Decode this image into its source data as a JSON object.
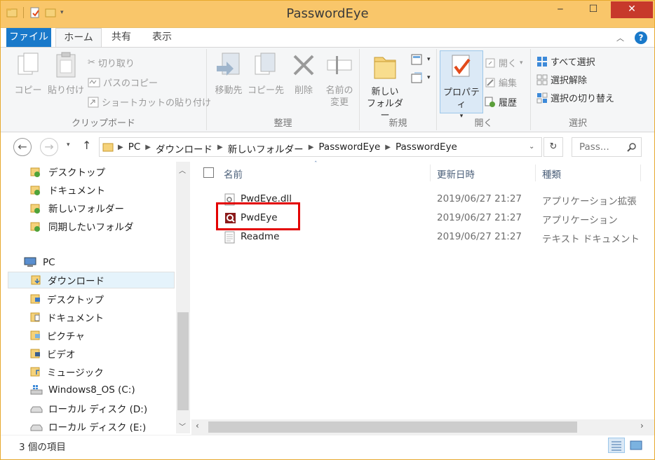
{
  "window": {
    "title": "PasswordEye",
    "controls": {
      "minimize": "‒",
      "maximize": "☐",
      "close": "✕"
    }
  },
  "tabs": {
    "file": "ファイル",
    "home": "ホーム",
    "share": "共有",
    "view": "表示",
    "help": "?"
  },
  "ribbon": {
    "clipboard": {
      "label": "クリップボード",
      "copy": "コピー",
      "paste": "貼り付け",
      "cut": "切り取り",
      "copy_path": "パスのコピー",
      "paste_shortcut": "ショートカットの貼り付け"
    },
    "organize": {
      "label": "整理",
      "move_to": "移動先",
      "copy_to": "コピー先",
      "delete": "削除",
      "rename_line1": "名前の",
      "rename_line2": "変更"
    },
    "new": {
      "label": "新規",
      "new_folder_line1": "新しい",
      "new_folder_line2": "フォルダー"
    },
    "open": {
      "label": "開く",
      "properties": "プロパティ",
      "open": "開く",
      "edit": "編集",
      "history": "履歴"
    },
    "select": {
      "label": "選択",
      "select_all": "すべて選択",
      "select_none": "選択解除",
      "invert": "選択の切り替え"
    }
  },
  "address": {
    "crumbs": [
      "PC",
      "ダウンロード",
      "新しいフォルダー",
      "PasswordEye",
      "PasswordEye"
    ],
    "search_placeholder": "Pass..."
  },
  "nav": {
    "favorites": [
      "デスクトップ",
      "ドキュメント",
      "新しいフォルダー",
      "同期したいフォルダ"
    ],
    "pc_label": "PC",
    "pc_items": [
      "ダウンロード",
      "デスクトップ",
      "ドキュメント",
      "ピクチャ",
      "ビデオ",
      "ミュージック",
      "Windows8_OS (C:)",
      "ローカル ディスク (D:)",
      "ローカル ディスク (E:)"
    ],
    "selected": "ダウンロード"
  },
  "files": {
    "columns": {
      "name": "名前",
      "modified": "更新日時",
      "type": "種類"
    },
    "rows": [
      {
        "name": "PwdEye.dll",
        "modified": "2019/06/27 21:27",
        "type": "アプリケーション拡張",
        "icon": "dll-icon"
      },
      {
        "name": "PwdEye",
        "modified": "2019/06/27 21:27",
        "type": "アプリケーション",
        "icon": "app-icon"
      },
      {
        "name": "Readme",
        "modified": "2019/06/27 21:27",
        "type": "テキスト ドキュメント",
        "icon": "text-file-icon"
      }
    ],
    "highlight_color": "#e30000"
  },
  "status": {
    "item_count": "3 個の項目"
  },
  "colors": {
    "title_bar": "#f9c66a",
    "file_tab": "#1979ca",
    "selection": "#e5f3fb"
  }
}
